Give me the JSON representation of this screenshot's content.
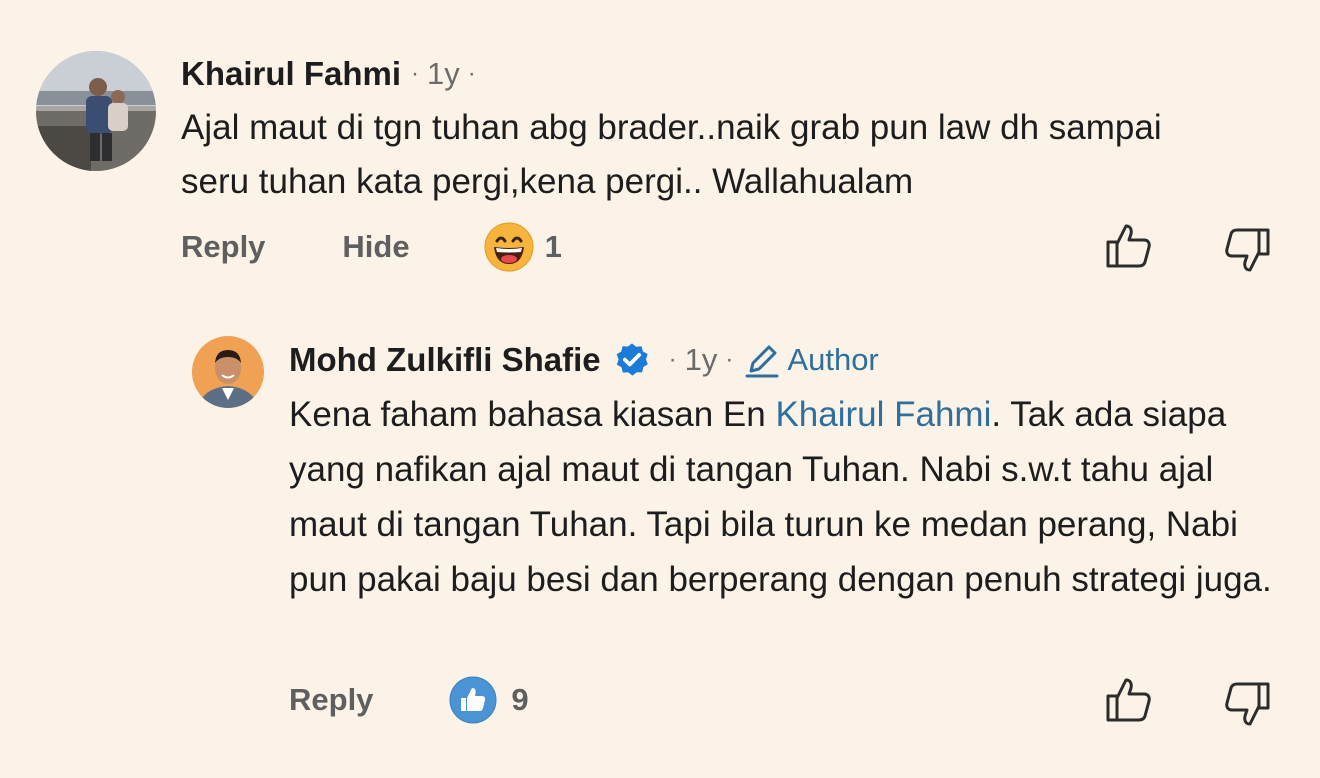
{
  "comments": [
    {
      "name": "Khairul Fahmi",
      "time": "1y",
      "text": "Ajal maut di tgn tuhan abg brader..naik grab pun law dh sampai seru tuhan kata pergi,kena pergi.. Wallahualam",
      "actions": {
        "reply": "Reply",
        "hide": "Hide"
      },
      "reaction": {
        "icon": "laughing-emoji-icon",
        "count": "1"
      }
    },
    {
      "name": "Mohd Zulkifli Shafie",
      "time": "1y",
      "author_label": "Author",
      "text_before": "Kena faham bahasa kiasan En ",
      "mention": "Khairul Fahmi",
      "text_after": ". Tak ada siapa yang nafikan ajal maut di tangan Tuhan. Nabi s.w.t tahu ajal maut di tangan Tuhan. Tapi bila turun ke medan perang, Nabi pun pakai baju besi dan berperang dengan penuh strategi juga.",
      "actions": {
        "reply": "Reply"
      },
      "reaction": {
        "icon": "like-icon",
        "count": "9"
      }
    }
  ],
  "colors": {
    "background": "#fbf3e7",
    "link": "#2f6f9e",
    "verified": "#1d7bd8",
    "like_badge": "#4a94d6"
  }
}
